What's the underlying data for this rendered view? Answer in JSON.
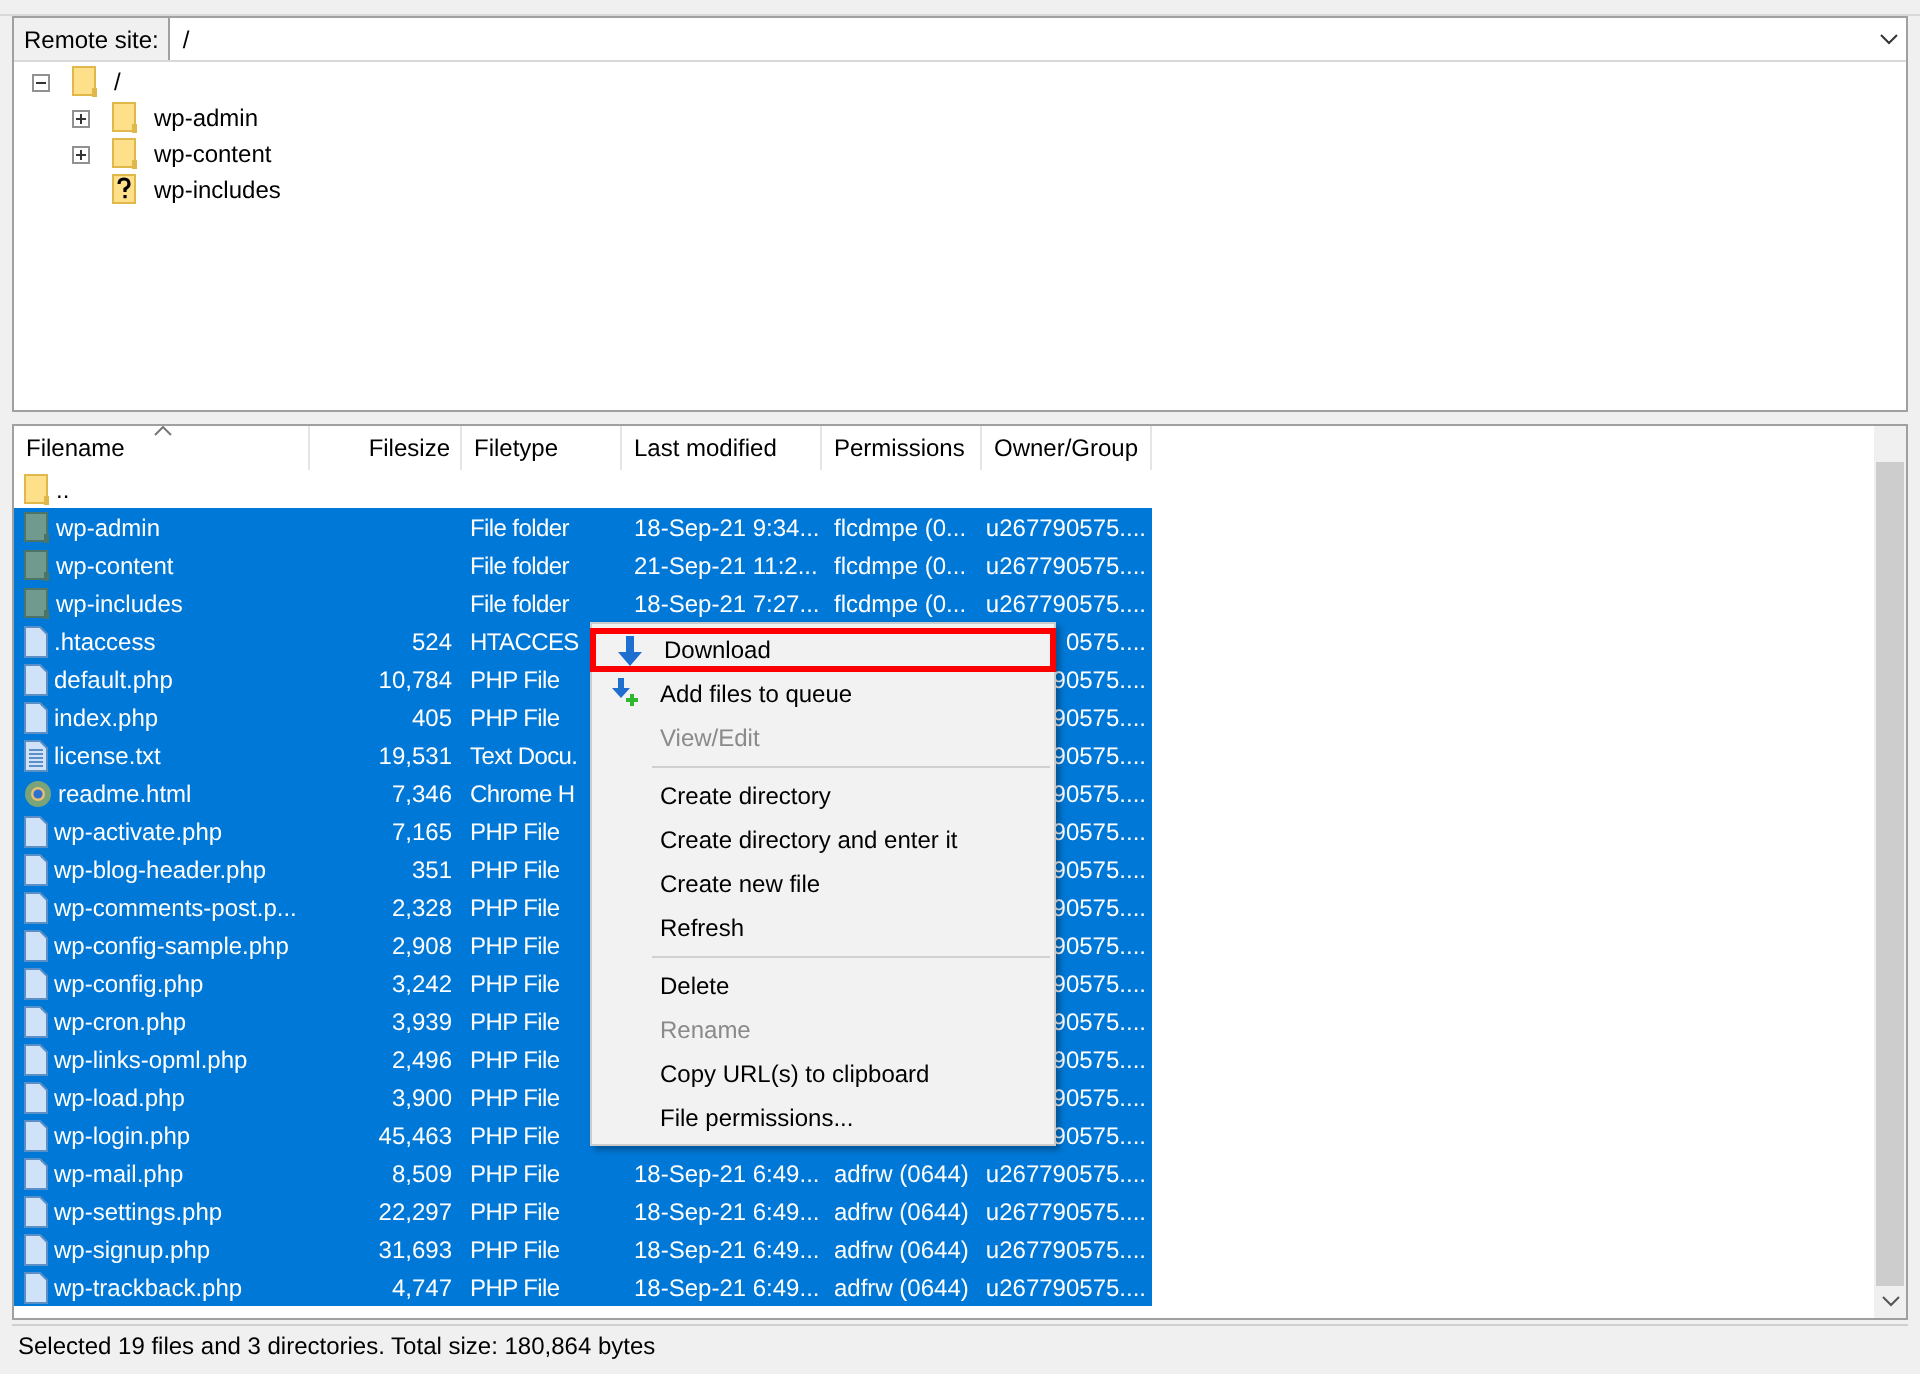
{
  "remote_site": {
    "label": "Remote site:",
    "path": "/"
  },
  "tree": {
    "label": "/",
    "expanded": true,
    "kind": "folder",
    "children": [
      {
        "label": "wp-admin",
        "expanded": false,
        "kind": "folder"
      },
      {
        "label": "wp-content",
        "expanded": false,
        "kind": "folder"
      },
      {
        "label": "wp-includes",
        "kind": "unknown"
      }
    ]
  },
  "file_list": {
    "columns": [
      {
        "label": "Filename",
        "sorted": true
      },
      {
        "label": "Filesize",
        "sorted": false
      },
      {
        "label": "Filetype",
        "sorted": false
      },
      {
        "label": "Last modified",
        "sorted": false
      },
      {
        "label": "Permissions",
        "sorted": false
      },
      {
        "label": "Owner/Group",
        "sorted": false
      }
    ],
    "rows": [
      {
        "name": "..",
        "kind": "folder",
        "selected": false
      },
      {
        "name": "wp-admin",
        "kind": "dir",
        "type": "File folder",
        "modified": "18-Sep-21 9:34...",
        "permissions": "flcdmpe (0...",
        "owner": "u267790575....",
        "selected": true
      },
      {
        "name": "wp-content",
        "kind": "dir",
        "type": "File folder",
        "modified": "21-Sep-21 11:2...",
        "permissions": "flcdmpe (0...",
        "owner": "u267790575....",
        "selected": true
      },
      {
        "name": "wp-includes",
        "kind": "dir",
        "type": "File folder",
        "modified": "18-Sep-21 7:27...",
        "permissions": "flcdmpe (0...",
        "owner": "u267790575....",
        "selected": true
      },
      {
        "name": ".htaccess",
        "kind": "file",
        "size": "524",
        "type": "HTACCES",
        "owner": "0575....",
        "selected": true
      },
      {
        "name": "default.php",
        "kind": "file",
        "size": "10,784",
        "type": "PHP File",
        "owner": "90575....",
        "selected": true
      },
      {
        "name": "index.php",
        "kind": "file",
        "size": "405",
        "type": "PHP File",
        "owner": "90575....",
        "selected": true
      },
      {
        "name": "license.txt",
        "kind": "text",
        "size": "19,531",
        "type": "Text Docu.",
        "owner": "90575....",
        "selected": true
      },
      {
        "name": "readme.html",
        "kind": "web",
        "size": "7,346",
        "type": "Chrome H",
        "owner": "90575....",
        "selected": true
      },
      {
        "name": "wp-activate.php",
        "kind": "file",
        "size": "7,165",
        "type": "PHP File",
        "owner": "90575....",
        "selected": true
      },
      {
        "name": "wp-blog-header.php",
        "kind": "file",
        "size": "351",
        "type": "PHP File",
        "owner": "90575....",
        "selected": true
      },
      {
        "name": "wp-comments-post.p...",
        "kind": "file",
        "size": "2,328",
        "type": "PHP File",
        "owner": "90575....",
        "selected": true
      },
      {
        "name": "wp-config-sample.php",
        "kind": "file",
        "size": "2,908",
        "type": "PHP File",
        "owner": "90575....",
        "selected": true
      },
      {
        "name": "wp-config.php",
        "kind": "file",
        "size": "3,242",
        "type": "PHP File",
        "owner": "90575....",
        "selected": true
      },
      {
        "name": "wp-cron.php",
        "kind": "file",
        "size": "3,939",
        "type": "PHP File",
        "owner": "90575....",
        "selected": true
      },
      {
        "name": "wp-links-opml.php",
        "kind": "file",
        "size": "2,496",
        "type": "PHP File",
        "owner": "90575....",
        "selected": true
      },
      {
        "name": "wp-load.php",
        "kind": "file",
        "size": "3,900",
        "type": "PHP File",
        "owner": "90575....",
        "selected": true
      },
      {
        "name": "wp-login.php",
        "kind": "file",
        "size": "45,463",
        "type": "PHP File",
        "owner": "90575....",
        "selected": true
      },
      {
        "name": "wp-mail.php",
        "kind": "file",
        "size": "8,509",
        "type": "PHP File",
        "modified": "18-Sep-21 6:49...",
        "permissions": "adfrw (0644)",
        "owner": "u267790575....",
        "selected": true
      },
      {
        "name": "wp-settings.php",
        "kind": "file",
        "size": "22,297",
        "type": "PHP File",
        "modified": "18-Sep-21 6:49...",
        "permissions": "adfrw (0644)",
        "owner": "u267790575....",
        "selected": true
      },
      {
        "name": "wp-signup.php",
        "kind": "file",
        "size": "31,693",
        "type": "PHP File",
        "modified": "18-Sep-21 6:49...",
        "permissions": "adfrw (0644)",
        "owner": "u267790575....",
        "selected": true
      },
      {
        "name": "wp-trackback.php",
        "kind": "file",
        "size": "4,747",
        "type": "PHP File",
        "modified": "18-Sep-21 6:49...",
        "permissions": "adfrw (0644)",
        "owner": "u267790575....",
        "selected": true
      }
    ]
  },
  "context_menu": [
    {
      "kind": "item",
      "label": "Download",
      "highlighted": true
    },
    {
      "kind": "item",
      "label": "Add files to queue",
      "highlighted": false
    },
    {
      "kind": "disabled",
      "label": "View/Edit"
    },
    {
      "kind": "separator"
    },
    {
      "kind": "item",
      "label": "Create directory",
      "highlighted": false
    },
    {
      "kind": "item",
      "label": "Create directory and enter it",
      "highlighted": false
    },
    {
      "kind": "item",
      "label": "Create new file",
      "highlighted": false
    },
    {
      "kind": "item",
      "label": "Refresh",
      "highlighted": false
    },
    {
      "kind": "separator"
    },
    {
      "kind": "item",
      "label": "Delete",
      "highlighted": false
    },
    {
      "kind": "disabled",
      "label": "Rename"
    },
    {
      "kind": "item",
      "label": "Copy URL(s) to clipboard",
      "highlighted": false
    },
    {
      "kind": "item",
      "label": "File permissions...",
      "highlighted": false
    }
  ],
  "status_bar": "Selected 19 files and 3 directories. Total size: 180,864 bytes"
}
